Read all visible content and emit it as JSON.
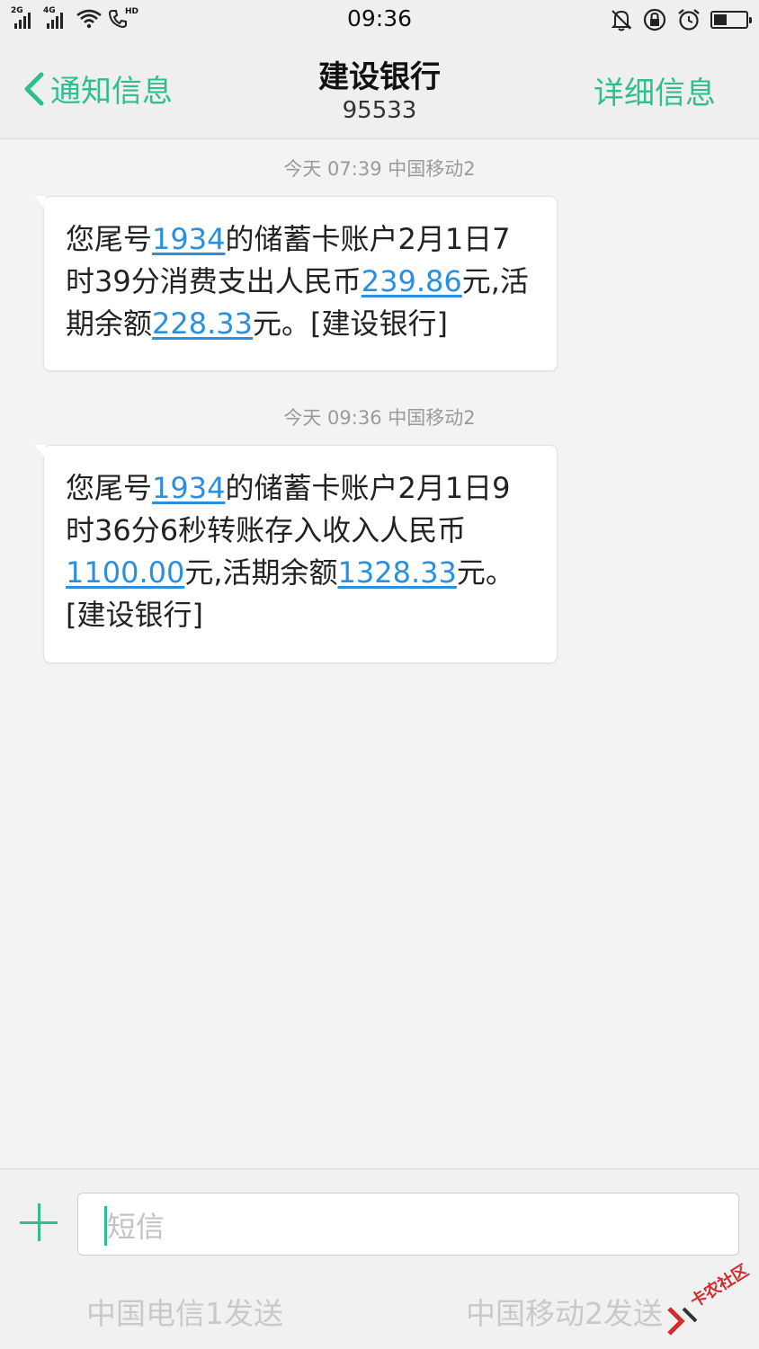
{
  "status_bar": {
    "signal1_label": "2G",
    "signal2_label": "4G",
    "hd_label": "HD",
    "time": "09:36",
    "icons": [
      "signal-icon",
      "wifi-icon",
      "hd-call-icon",
      "mute-bell-icon",
      "rotation-lock-icon",
      "alarm-icon",
      "battery-icon"
    ]
  },
  "header": {
    "back_label": "通知信息",
    "title": "建设银行",
    "number": "95533",
    "detail_label": "详细信息"
  },
  "messages": [
    {
      "timestamp": "今天 07:39  中国移动2",
      "parts": [
        {
          "t": "您尾号",
          "link": false
        },
        {
          "t": "1934",
          "link": true
        },
        {
          "t": "的储蓄卡账户2月1日7时39分消费支出人民币",
          "link": false
        },
        {
          "t": "239.86",
          "link": true
        },
        {
          "t": "元,活期余额",
          "link": false
        },
        {
          "t": "228.33",
          "link": true
        },
        {
          "t": "元。[建设银行]",
          "link": false
        }
      ]
    },
    {
      "timestamp": "今天 09:36  中国移动2",
      "parts": [
        {
          "t": "您尾号",
          "link": false
        },
        {
          "t": "1934",
          "link": true
        },
        {
          "t": "的储蓄卡账户2月1日9时36分6秒转账存入收入人民币",
          "link": false
        },
        {
          "t": "1100.00",
          "link": true
        },
        {
          "t": "元,活期余额",
          "link": false
        },
        {
          "t": "1328.33",
          "link": true
        },
        {
          "t": "元。[建设银行]",
          "link": false
        }
      ]
    }
  ],
  "composer": {
    "placeholder": "短信",
    "send_sim1": "中国电信1发送",
    "send_sim2": "中国移动2发送"
  },
  "watermark": "卡农社区",
  "colors": {
    "accent": "#2fbf8f",
    "link": "#2b8fe0",
    "background": "#f3f3f3"
  }
}
